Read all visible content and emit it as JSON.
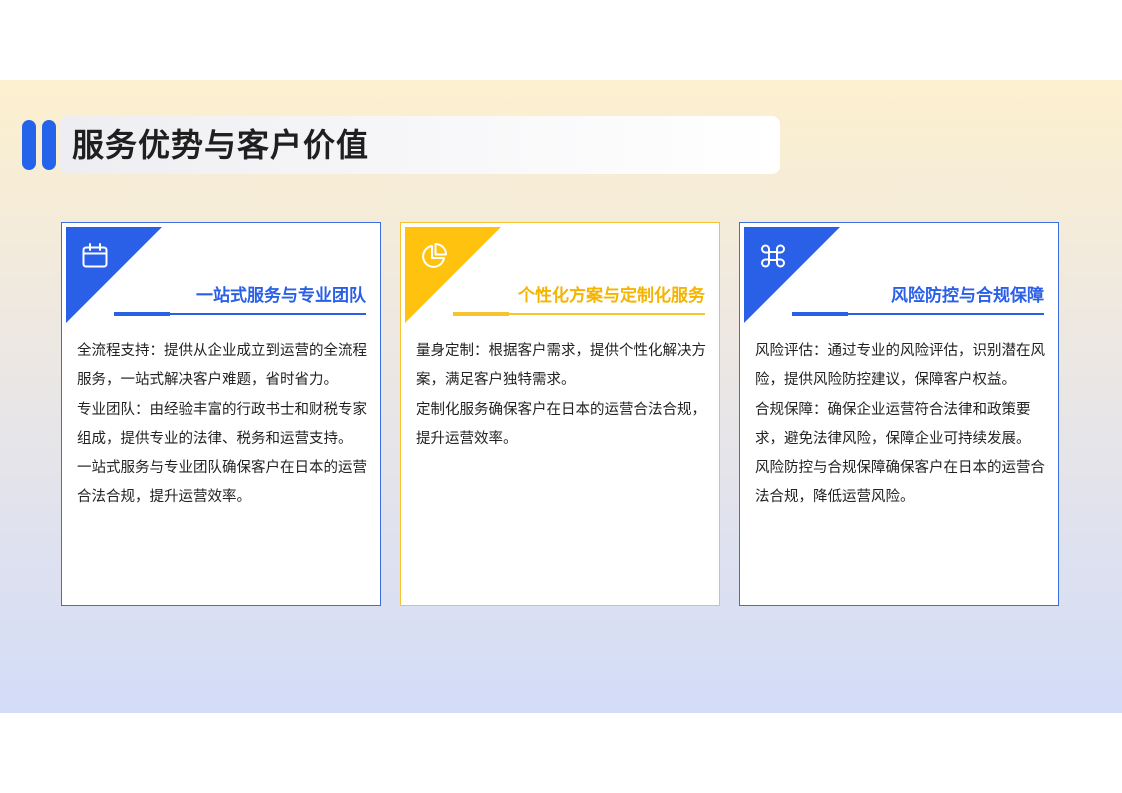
{
  "page": {
    "title": "服务优势与客户价值"
  },
  "colors": {
    "accent_blue": "#2a5fe8",
    "accent_yellow": "#ffc20e"
  },
  "cards": [
    {
      "icon": "calendar-icon",
      "title": "一站式服务与专业团队",
      "paragraphs": [
        "全流程支持：提供从企业成立到运营的全流程服务，一站式解决客户难题，省时省力。",
        "专业团队：由经验丰富的行政书士和财税专家组成，提供专业的法律、税务和运营支持。",
        "一站式服务与专业团队确保客户在日本的运营合法合规，提升运营效率。"
      ]
    },
    {
      "icon": "pie-chart-icon",
      "title": "个性化方案与定制化服务",
      "paragraphs": [
        "量身定制：根据客户需求，提供个性化解决方案，满足客户独特需求。",
        "定制化服务确保客户在日本的运营合法合规，提升运营效率。"
      ]
    },
    {
      "icon": "command-icon",
      "title": "风险防控与合规保障",
      "paragraphs": [
        "风险评估：通过专业的风险评估，识别潜在风险，提供风险防控建议，保障客户权益。",
        "合规保障：确保企业运营符合法律和政策要求，避免法律风险，保障企业可持续发展。",
        "风险防控与合规保障确保客户在日本的运营合法合规，降低运营风险。"
      ]
    }
  ]
}
